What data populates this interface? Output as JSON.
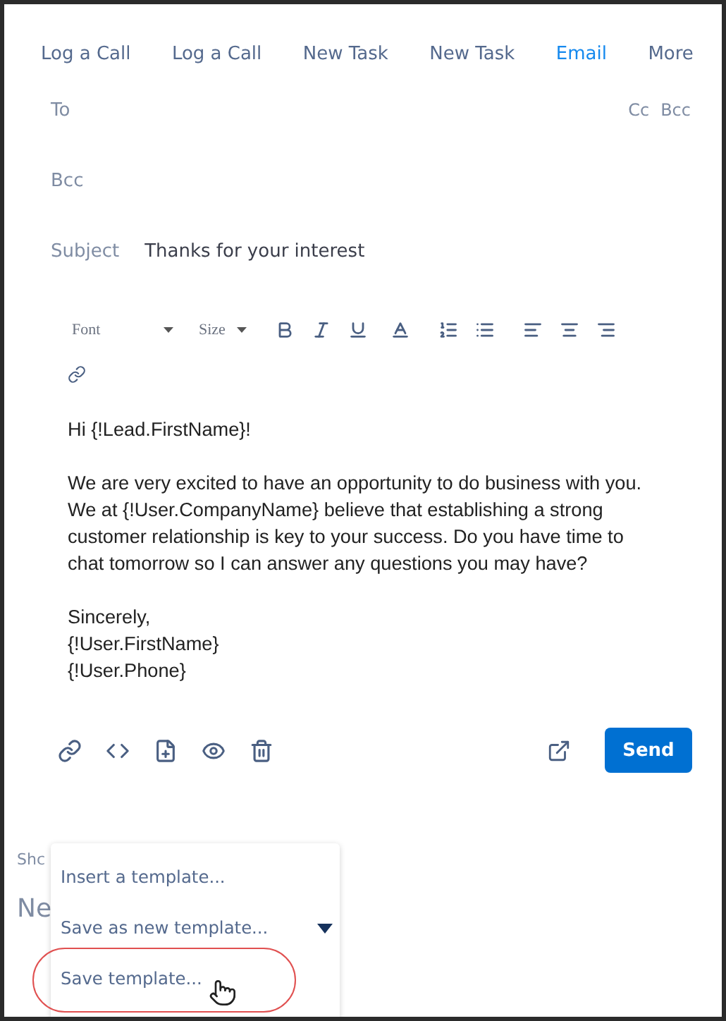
{
  "tabs": [
    {
      "label": "Log a Call",
      "selected": false
    },
    {
      "label": "Log a Call",
      "selected": false
    },
    {
      "label": "New Task",
      "selected": false
    },
    {
      "label": "New Task",
      "selected": false
    },
    {
      "label": "Email",
      "selected": true
    },
    {
      "label": "More",
      "selected": false
    }
  ],
  "fields": [
    {
      "kind": "recipients",
      "label": "To",
      "links": [
        "Cc",
        "Bcc"
      ]
    },
    {
      "kind": "recipients",
      "label": "Bcc"
    },
    {
      "kind": "subject",
      "label": "Subject",
      "value": "Thanks for your interest"
    }
  ],
  "toolbar": {
    "font": "Font",
    "size": "Size"
  },
  "body": {
    "paragraphs": [
      [
        "Hi {!Lead.FirstName}!"
      ],
      [
        "We are very excited to have an opportunity to do business with you.",
        "We at {!User.CompanyName} believe that establishing a strong",
        "customer relationship is key to your success. Do you have time to",
        "chat tomorrow so I can answer any questions you may have?"
      ],
      [
        "Sincerely,",
        "{!User.FirstName}",
        "{!User.Phone}"
      ]
    ]
  },
  "send_button": "Send",
  "background_labels": [
    "Shc",
    "Ne"
  ],
  "template_menu": {
    "items": [
      {
        "label": "Insert a template...",
        "caret": false,
        "circled": false
      },
      {
        "label": "Save as new template...",
        "caret": true,
        "circled": false
      },
      {
        "label": "Save template...",
        "caret": false,
        "circled": true
      }
    ]
  }
}
